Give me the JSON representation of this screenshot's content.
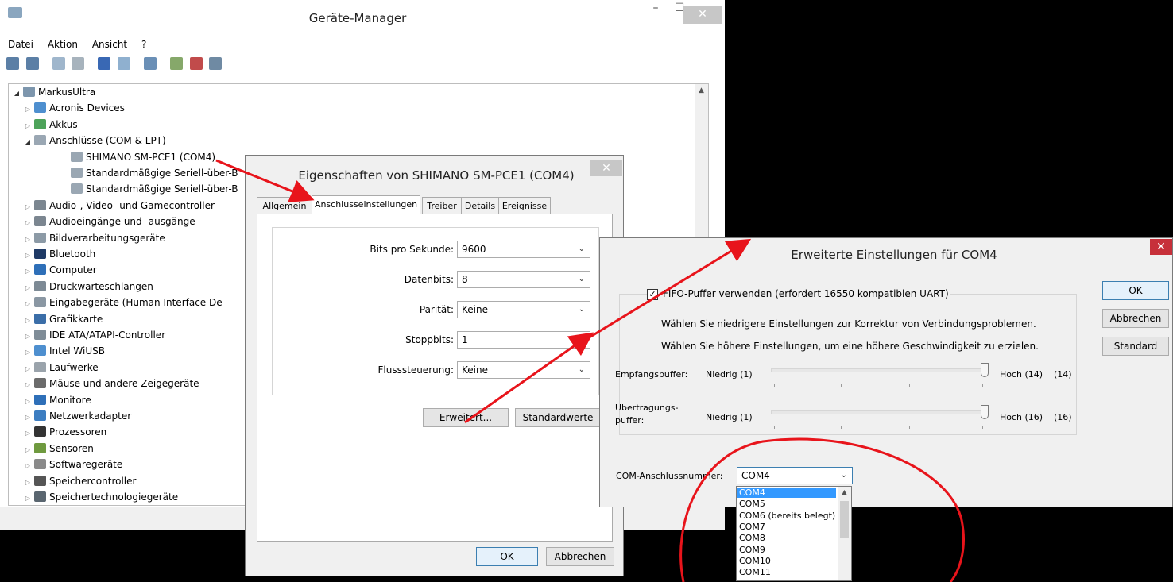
{
  "device_manager": {
    "title": "Geräte-Manager",
    "menu": [
      "Datei",
      "Aktion",
      "Ansicht",
      "?"
    ],
    "tree": [
      {
        "label": "MarkusUltra",
        "level": 0,
        "expanded": true,
        "icon": "computer-icon"
      },
      {
        "label": "Acronis Devices",
        "level": 1,
        "icon": "device-icon"
      },
      {
        "label": "Akkus",
        "level": 1,
        "icon": "battery-icon"
      },
      {
        "label": "Anschlüsse (COM & LPT)",
        "level": 1,
        "expanded": true,
        "icon": "port-icon"
      },
      {
        "label": "SHIMANO SM-PCE1 (COM4)",
        "level": 2,
        "icon": "port-icon"
      },
      {
        "label": "Standardmäßgige Seriell-über-B",
        "level": 2,
        "icon": "port-icon"
      },
      {
        "label": "Standardmäßgige Seriell-über-B",
        "level": 2,
        "icon": "port-icon"
      },
      {
        "label": "Audio-, Video- und Gamecontroller",
        "level": 1,
        "icon": "speaker-icon"
      },
      {
        "label": "Audioeingänge und -ausgänge",
        "level": 1,
        "icon": "speaker-icon"
      },
      {
        "label": "Bildverarbeitungsgeräte",
        "level": 1,
        "icon": "camera-icon"
      },
      {
        "label": "Bluetooth",
        "level": 1,
        "icon": "bluetooth-icon"
      },
      {
        "label": "Computer",
        "level": 1,
        "icon": "monitor-icon"
      },
      {
        "label": "Druckwarteschlangen",
        "level": 1,
        "icon": "printer-icon"
      },
      {
        "label": "Eingabegeräte (Human Interface De",
        "level": 1,
        "icon": "hid-icon"
      },
      {
        "label": "Grafikkarte",
        "level": 1,
        "icon": "display-adapter-icon"
      },
      {
        "label": "IDE ATA/ATAPI-Controller",
        "level": 1,
        "icon": "drive-controller-icon"
      },
      {
        "label": "Intel WiUSB",
        "level": 1,
        "icon": "device-icon"
      },
      {
        "label": "Laufwerke",
        "level": 1,
        "icon": "drive-icon"
      },
      {
        "label": "Mäuse und andere Zeigegeräte",
        "level": 1,
        "icon": "mouse-icon"
      },
      {
        "label": "Monitore",
        "level": 1,
        "icon": "monitor-icon"
      },
      {
        "label": "Netzwerkadapter",
        "level": 1,
        "icon": "network-icon"
      },
      {
        "label": "Prozessoren",
        "level": 1,
        "icon": "cpu-icon"
      },
      {
        "label": "Sensoren",
        "level": 1,
        "icon": "sensor-icon"
      },
      {
        "label": "Softwaregeräte",
        "level": 1,
        "icon": "software-icon"
      },
      {
        "label": "Speichercontroller",
        "level": 1,
        "icon": "storage-controller-icon"
      },
      {
        "label": "Speichertechnologiegeräte",
        "level": 1,
        "icon": "storage-icon"
      }
    ]
  },
  "properties_dialog": {
    "title": "Eigenschaften von SHIMANO SM-PCE1 (COM4)",
    "tabs": [
      "Allgemein",
      "Anschlusseinstellungen",
      "Treiber",
      "Details",
      "Ereignisse"
    ],
    "active_tab": "Anschlusseinstellungen",
    "fields": [
      {
        "label": "Bits pro Sekunde:",
        "value": "9600"
      },
      {
        "label": "Datenbits:",
        "value": "8"
      },
      {
        "label": "Parität:",
        "value": "Keine"
      },
      {
        "label": "Stoppbits:",
        "value": "1"
      },
      {
        "label": "Flusssteuerung:",
        "value": "Keine"
      }
    ],
    "advanced_button": "Erweitert...",
    "defaults_button": "Standardwerte",
    "ok_button": "OK",
    "cancel_button": "Abbrechen"
  },
  "advanced_dialog": {
    "title": "Erweiterte Einstellungen für COM4",
    "fifo_checkbox": "FIFO-Puffer verwenden (erfordert 16550 kompatiblen UART)",
    "fifo_checked": true,
    "hint1": "Wählen Sie niedrigere Einstellungen zur Korrektur von Verbindungsproblemen.",
    "hint2": "Wählen Sie höhere Einstellungen, um eine höhere Geschwindigkeit zu erzielen.",
    "receive": {
      "label": "Empfangspuffer:",
      "low": "Niedrig (1)",
      "high": "Hoch (14)",
      "value": "(14)"
    },
    "transmit": {
      "label1": "Übertragungs-",
      "label2": "puffer:",
      "low": "Niedrig (1)",
      "high": "Hoch (16)",
      "value": "(16)"
    },
    "com_label": "COM-Anschlussnummer:",
    "com_value": "COM4",
    "com_options": [
      "COM4",
      "COM5",
      "COM6 (bereits belegt)",
      "COM7",
      "COM8",
      "COM9",
      "COM10",
      "COM11"
    ],
    "ok_button": "OK",
    "cancel_button": "Abbrechen",
    "defaults_button": "Standard"
  },
  "colors": {
    "arrow": "#e8141b",
    "selection": "#3399ff",
    "close_red": "#c7303a"
  }
}
